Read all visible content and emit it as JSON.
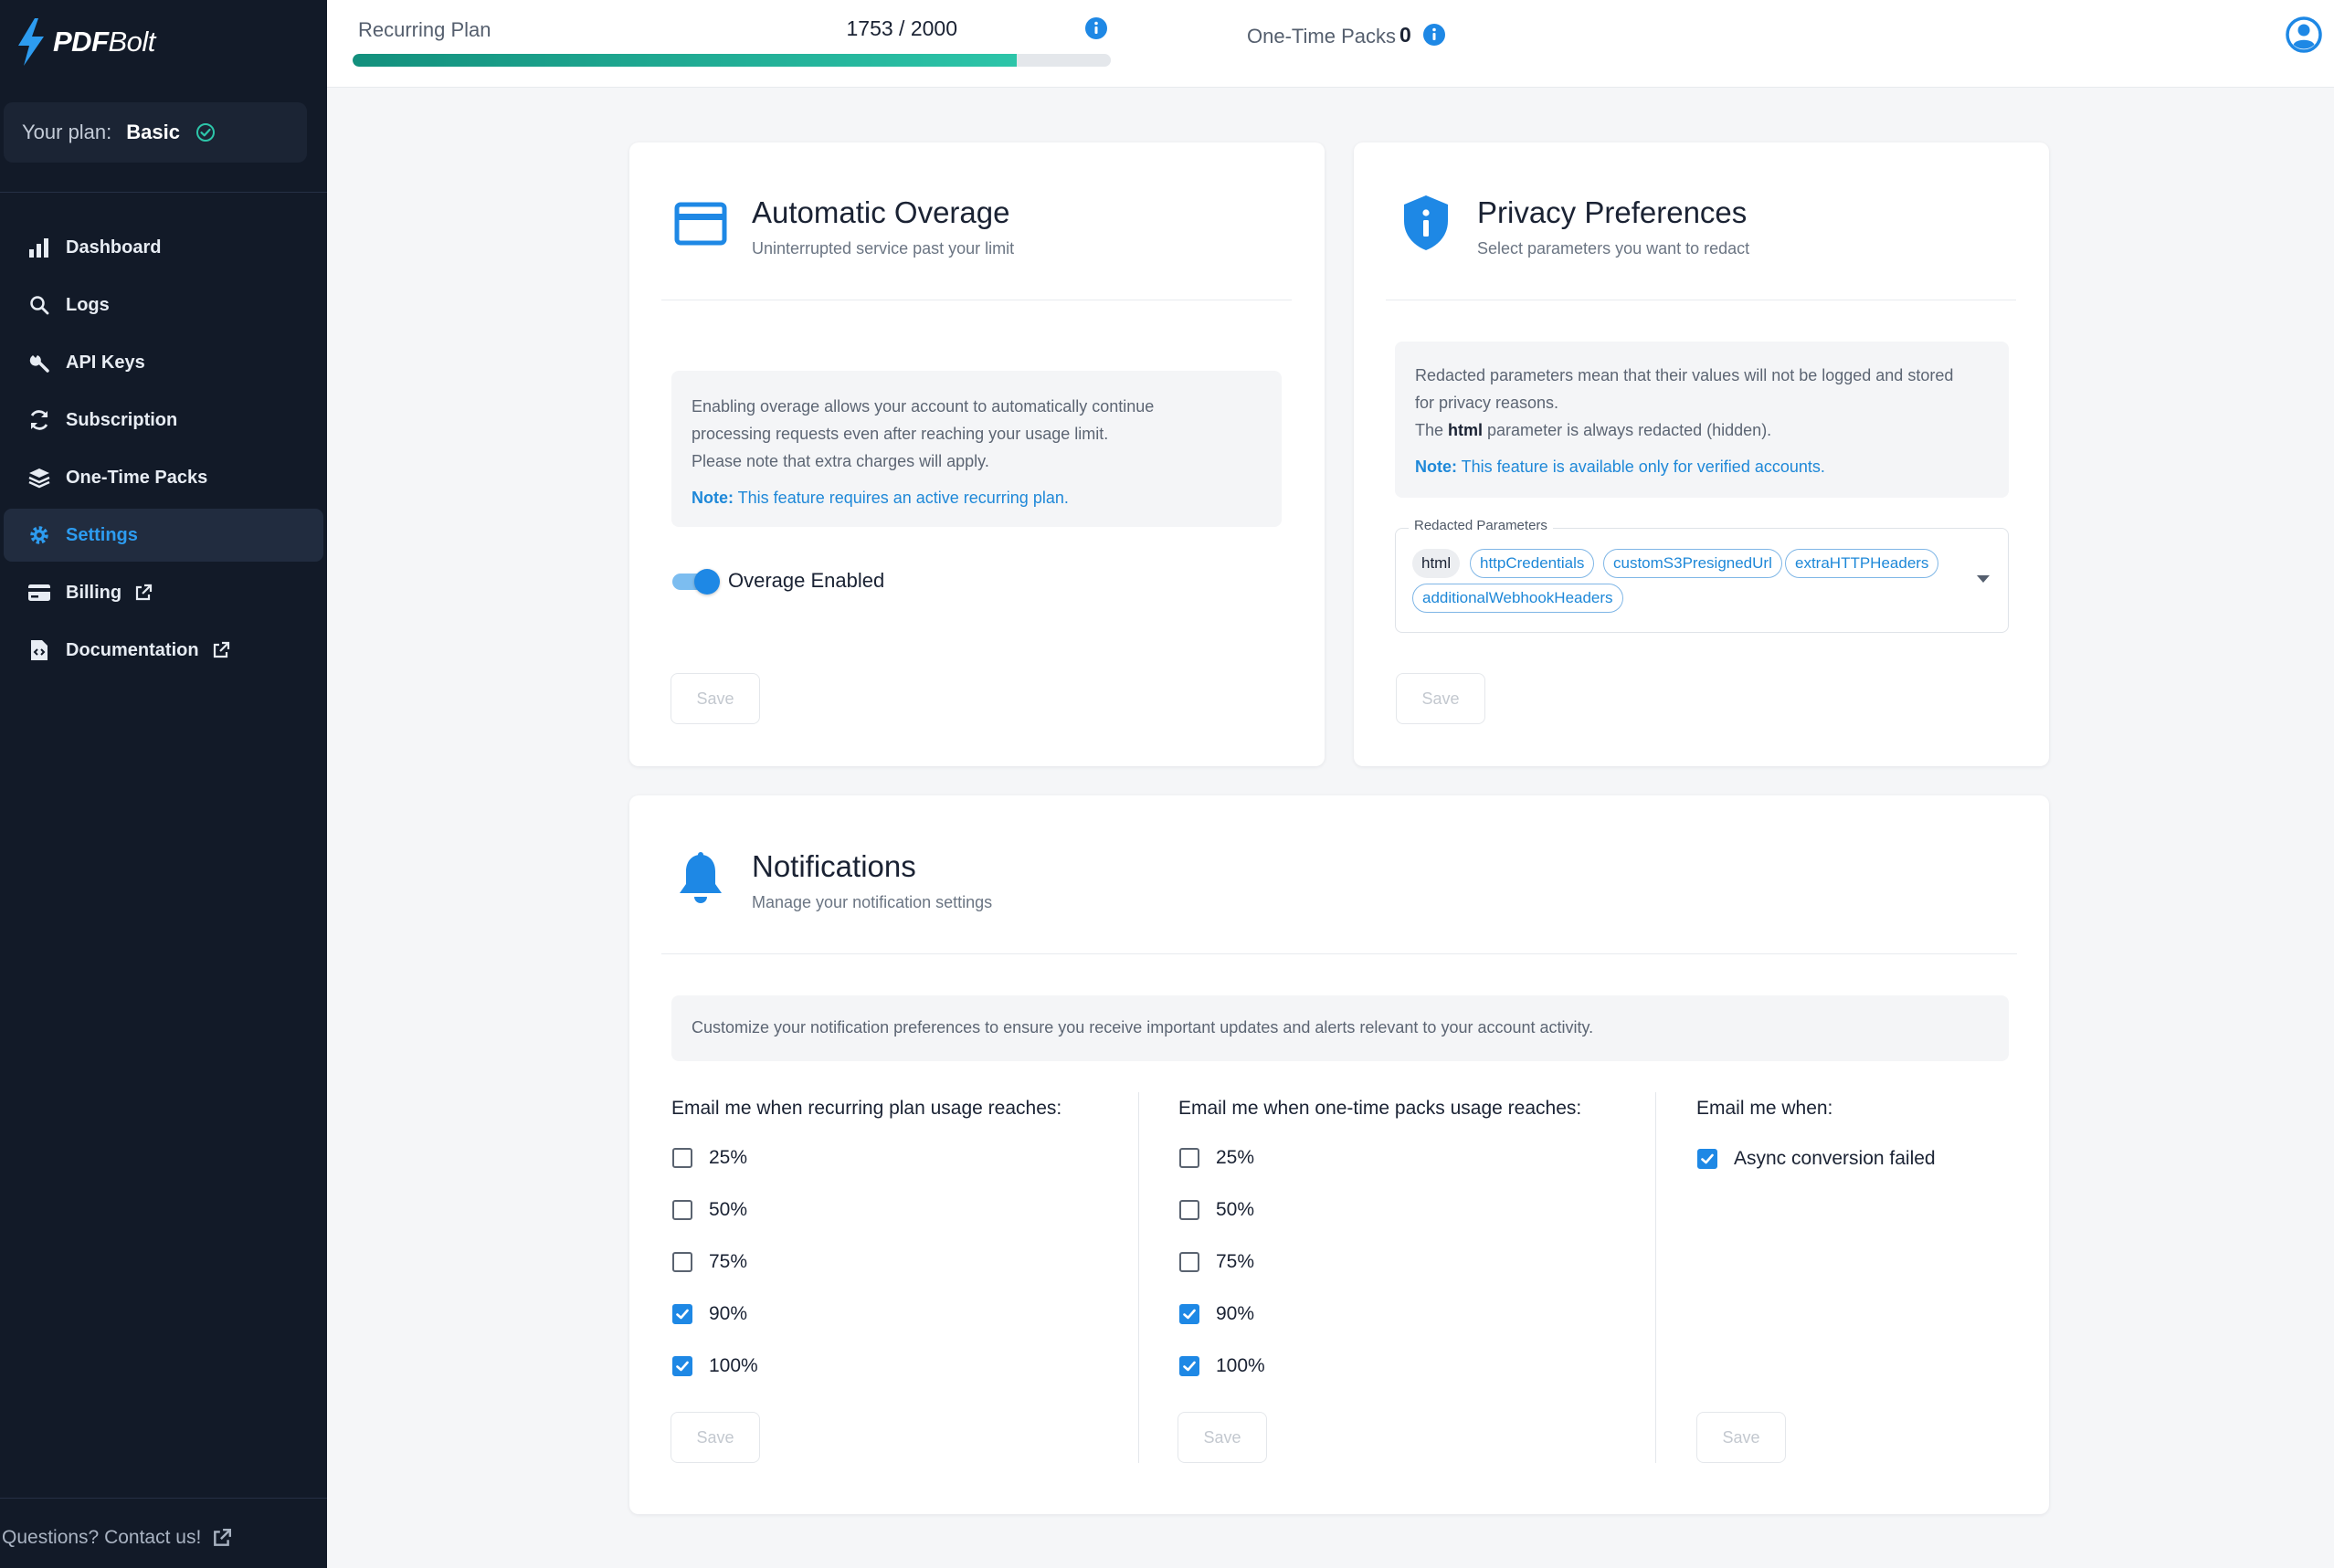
{
  "brand": {
    "name_bold": "PDF",
    "name_light": "Bolt"
  },
  "plan": {
    "label": "Your plan:",
    "value": "Basic"
  },
  "nav": [
    {
      "label": "Dashboard",
      "icon": "bar-chart-icon",
      "active": false,
      "external": false
    },
    {
      "label": "Logs",
      "icon": "search-icon",
      "active": false,
      "external": false
    },
    {
      "label": "API Keys",
      "icon": "key-icon",
      "active": false,
      "external": false
    },
    {
      "label": "Subscription",
      "icon": "refresh-icon",
      "active": false,
      "external": false
    },
    {
      "label": "One-Time Packs",
      "icon": "layers-icon",
      "active": false,
      "external": false
    },
    {
      "label": "Settings",
      "icon": "gear-icon",
      "active": true,
      "external": false
    },
    {
      "label": "Billing",
      "icon": "credit-card-icon",
      "active": false,
      "external": true
    },
    {
      "label": "Documentation",
      "icon": "document-code-icon",
      "active": false,
      "external": true
    }
  ],
  "contact": "Questions? Contact us!",
  "usage": {
    "recurring_label": "Recurring Plan",
    "recurring_count": "1753 / 2000",
    "recurring_fraction": 0.8765,
    "onetime_label": "One-Time Packs",
    "onetime_value": "0"
  },
  "overage": {
    "title": "Automatic Overage",
    "subtitle": "Uninterrupted service past your limit",
    "info_line1": "Enabling overage allows your account to automatically continue",
    "info_line2": "processing requests even after reaching your usage limit.",
    "info_line3": "Please note that extra charges will apply.",
    "note_label": "Note:",
    "note_text": " This feature requires an active recurring plan.",
    "toggle_label": "Overage Enabled",
    "toggle_on": true,
    "save_label": "Save"
  },
  "privacy": {
    "title": "Privacy Preferences",
    "subtitle": "Select parameters you want to redact",
    "info_line1": "Redacted parameters mean that their values will not be logged and stored",
    "info_line2": "for privacy reasons.",
    "info_line3_pre": "The ",
    "info_line3_bold": "html",
    "info_line3_post": " parameter is always redacted (hidden).",
    "note_label": "Note:",
    "note_text": " This feature is available only for verified accounts.",
    "field_label": "Redacted Parameters",
    "chips": [
      "html",
      "httpCredentials",
      "customS3PresignedUrl",
      "extraHTTPHeaders",
      "additionalWebhookHeaders"
    ],
    "save_label": "Save"
  },
  "notifications": {
    "title": "Notifications",
    "subtitle": "Manage your notification settings",
    "info": "Customize your notification preferences to ensure you receive important updates and alerts relevant to your account activity.",
    "recurring": {
      "heading": "Email me when recurring plan usage reaches:",
      "options": [
        {
          "label": "25%",
          "checked": false
        },
        {
          "label": "50%",
          "checked": false
        },
        {
          "label": "75%",
          "checked": false
        },
        {
          "label": "90%",
          "checked": true
        },
        {
          "label": "100%",
          "checked": true
        }
      ],
      "save_label": "Save"
    },
    "onetime": {
      "heading": "Email me when one-time packs usage reaches:",
      "options": [
        {
          "label": "25%",
          "checked": false
        },
        {
          "label": "50%",
          "checked": false
        },
        {
          "label": "75%",
          "checked": false
        },
        {
          "label": "90%",
          "checked": true
        },
        {
          "label": "100%",
          "checked": true
        }
      ],
      "save_label": "Save"
    },
    "events": {
      "heading": "Email me when:",
      "options": [
        {
          "label": "Async conversion failed",
          "checked": true
        }
      ],
      "save_label": "Save"
    }
  },
  "colors": {
    "accent": "#1e88e5",
    "sidebar": "#121a28",
    "progress_start": "#13907d",
    "progress_end": "#2dc5a9"
  }
}
